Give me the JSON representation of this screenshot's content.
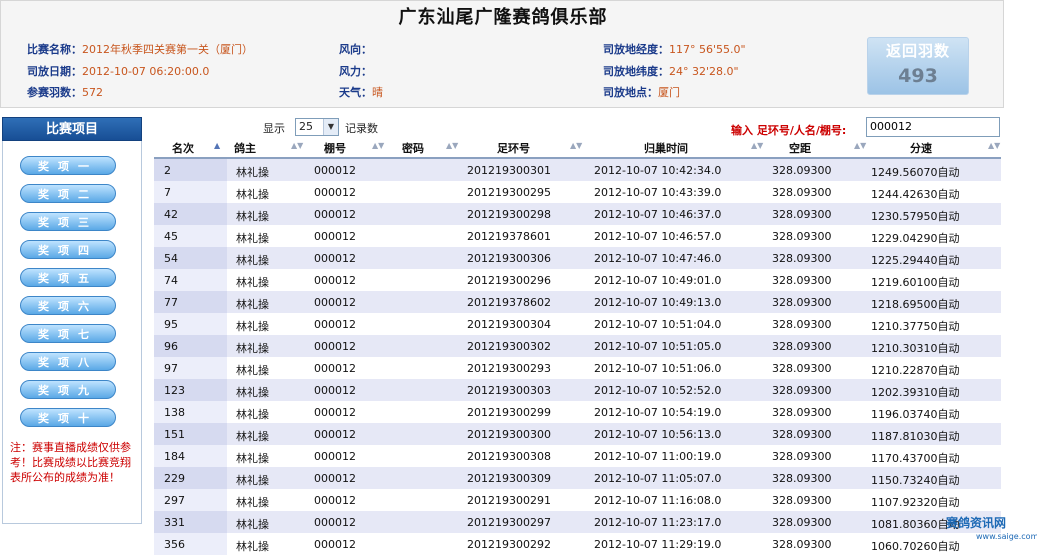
{
  "header": {
    "title": "广东汕尾广隆赛鸽俱乐部",
    "race_name_label": "比赛名称：",
    "race_name": "2012年秋季四关赛第一关（厦门）",
    "release_date_label": "司放日期：",
    "release_date": "2012-10-07 06:20:00.0",
    "entries_label": "参赛羽数：",
    "entries": "572",
    "wind_dir_label": "风向：",
    "wind_dir": "",
    "wind_power_label": "风力：",
    "wind_power": "",
    "weather_label": "天气：",
    "weather": "晴",
    "longitude_label": "司放地经度：",
    "longitude": "117° 56'55.0\"",
    "latitude_label": "司放地纬度：",
    "latitude": "24° 32'28.0\"",
    "release_place_label": "司放地点：",
    "release_place": "厦门",
    "return_badge_label": "返回羽数",
    "return_count": "493"
  },
  "sidebar": {
    "title": "比赛项目",
    "items": [
      "奖项一",
      "奖项二",
      "奖项三",
      "奖项四",
      "奖项五",
      "奖项六",
      "奖项七",
      "奖项八",
      "奖项九",
      "奖项十"
    ],
    "note": "注：赛事直播成绩仅供参考！比赛成绩以比赛竞翔表所公布的成绩为准！"
  },
  "controls": {
    "show_label": "显示",
    "page_size": "25",
    "records_label": "记录数",
    "search_label": "输入 足环号/人名/棚号:",
    "search_value": "000012"
  },
  "table": {
    "columns": [
      "名次",
      "鸽主",
      "棚号",
      "密码",
      "足环号",
      "归巢时间",
      "空距",
      "分速"
    ],
    "rows": [
      [
        "2",
        "林礼操",
        "000012",
        "",
        "201219300301",
        "2012-10-07 10:42:34.0",
        "328.09300",
        "1249.56070自动"
      ],
      [
        "7",
        "林礼操",
        "000012",
        "",
        "201219300295",
        "2012-10-07 10:43:39.0",
        "328.09300",
        "1244.42630自动"
      ],
      [
        "42",
        "林礼操",
        "000012",
        "",
        "201219300298",
        "2012-10-07 10:46:37.0",
        "328.09300",
        "1230.57950自动"
      ],
      [
        "45",
        "林礼操",
        "000012",
        "",
        "201219378601",
        "2012-10-07 10:46:57.0",
        "328.09300",
        "1229.04290自动"
      ],
      [
        "54",
        "林礼操",
        "000012",
        "",
        "201219300306",
        "2012-10-07 10:47:46.0",
        "328.09300",
        "1225.29440自动"
      ],
      [
        "74",
        "林礼操",
        "000012",
        "",
        "201219300296",
        "2012-10-07 10:49:01.0",
        "328.09300",
        "1219.60100自动"
      ],
      [
        "77",
        "林礼操",
        "000012",
        "",
        "201219378602",
        "2012-10-07 10:49:13.0",
        "328.09300",
        "1218.69500自动"
      ],
      [
        "95",
        "林礼操",
        "000012",
        "",
        "201219300304",
        "2012-10-07 10:51:04.0",
        "328.09300",
        "1210.37750自动"
      ],
      [
        "96",
        "林礼操",
        "000012",
        "",
        "201219300302",
        "2012-10-07 10:51:05.0",
        "328.09300",
        "1210.30310自动"
      ],
      [
        "97",
        "林礼操",
        "000012",
        "",
        "201219300293",
        "2012-10-07 10:51:06.0",
        "328.09300",
        "1210.22870自动"
      ],
      [
        "123",
        "林礼操",
        "000012",
        "",
        "201219300303",
        "2012-10-07 10:52:52.0",
        "328.09300",
        "1202.39310自动"
      ],
      [
        "138",
        "林礼操",
        "000012",
        "",
        "201219300299",
        "2012-10-07 10:54:19.0",
        "328.09300",
        "1196.03740自动"
      ],
      [
        "151",
        "林礼操",
        "000012",
        "",
        "201219300300",
        "2012-10-07 10:56:13.0",
        "328.09300",
        "1187.81030自动"
      ],
      [
        "184",
        "林礼操",
        "000012",
        "",
        "201219300308",
        "2012-10-07 11:00:19.0",
        "328.09300",
        "1170.43700自动"
      ],
      [
        "229",
        "林礼操",
        "000012",
        "",
        "201219300309",
        "2012-10-07 11:05:07.0",
        "328.09300",
        "1150.73240自动"
      ],
      [
        "297",
        "林礼操",
        "000012",
        "",
        "201219300291",
        "2012-10-07 11:16:08.0",
        "328.09300",
        "1107.92320自动"
      ],
      [
        "331",
        "林礼操",
        "000012",
        "",
        "201219300297",
        "2012-10-07 11:23:17.0",
        "328.09300",
        "1081.80360自动"
      ],
      [
        "356",
        "林礼操",
        "000012",
        "",
        "201219300292",
        "2012-10-07 11:29:19.0",
        "328.09300",
        "1060.70260自动"
      ]
    ]
  },
  "watermark": {
    "name": "赛鸽资讯网",
    "url": "www.saige.com"
  }
}
